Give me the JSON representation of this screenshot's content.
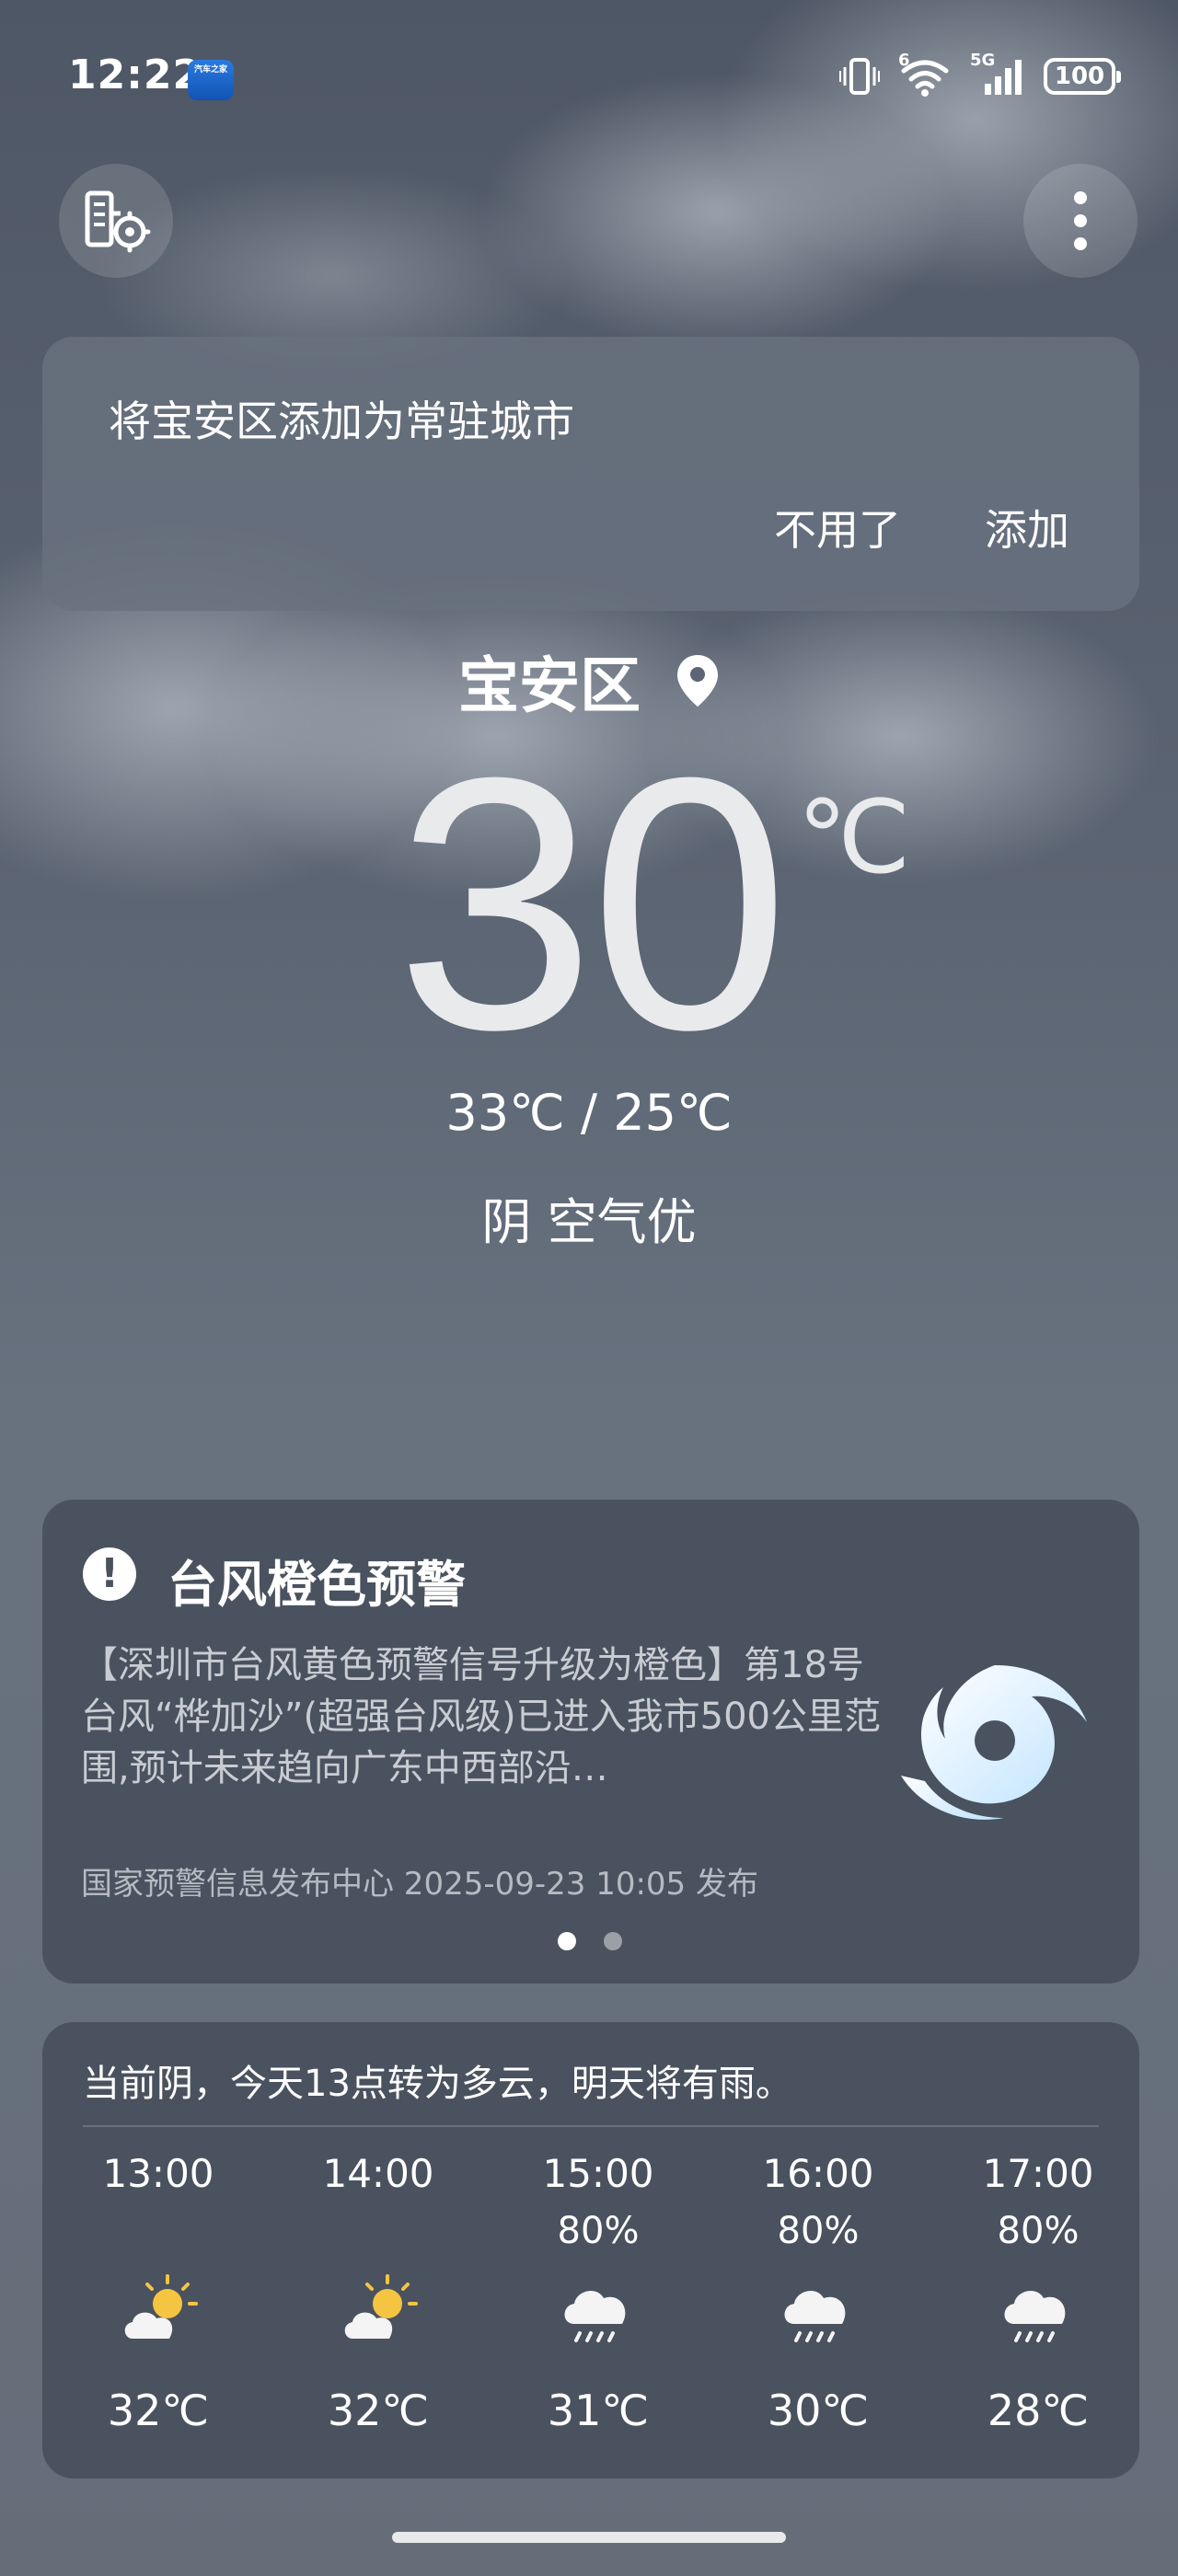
{
  "status_bar": {
    "time": "12:22",
    "app_icon_text": "汽车之家",
    "battery": "100",
    "network": "5G",
    "wifi_badge": "6"
  },
  "banner": {
    "title": "将宝安区添加为常驻城市",
    "dismiss_label": "不用了",
    "add_label": "添加"
  },
  "current": {
    "location": "宝安区",
    "temperature": "30",
    "unit": "℃",
    "high_low": "33℃ / 25℃",
    "condition": "阴  空气优"
  },
  "alert": {
    "title": "台风橙色预警",
    "body": "【深圳市台风黄色预警信号升级为橙色】第18号台风“桦加沙”(超强台风级)已进入我市500公里范围,预计未来趋向广东中西部沿…",
    "source": "国家预警信息发布中心 2025-09-23 10:05 发布",
    "page_index": 0,
    "page_count": 2
  },
  "hourly": {
    "summary": "当前阴，今天13点转为多云，明天将有雨。",
    "items": [
      {
        "time": "13:00",
        "precip": "",
        "icon": "partly-cloudy-icon",
        "temp": "32℃"
      },
      {
        "time": "14:00",
        "precip": "",
        "icon": "partly-cloudy-icon",
        "temp": "32℃"
      },
      {
        "time": "15:00",
        "precip": "80%",
        "icon": "rain-icon",
        "temp": "31℃"
      },
      {
        "time": "16:00",
        "precip": "80%",
        "icon": "rain-icon",
        "temp": "30℃"
      },
      {
        "time": "17:00",
        "precip": "80%",
        "icon": "rain-icon",
        "temp": "28℃"
      }
    ]
  },
  "colors": {
    "card": "#4a525f",
    "banner": "#69727f",
    "sun": "#f5c542",
    "typhoon": "#d6efff"
  }
}
